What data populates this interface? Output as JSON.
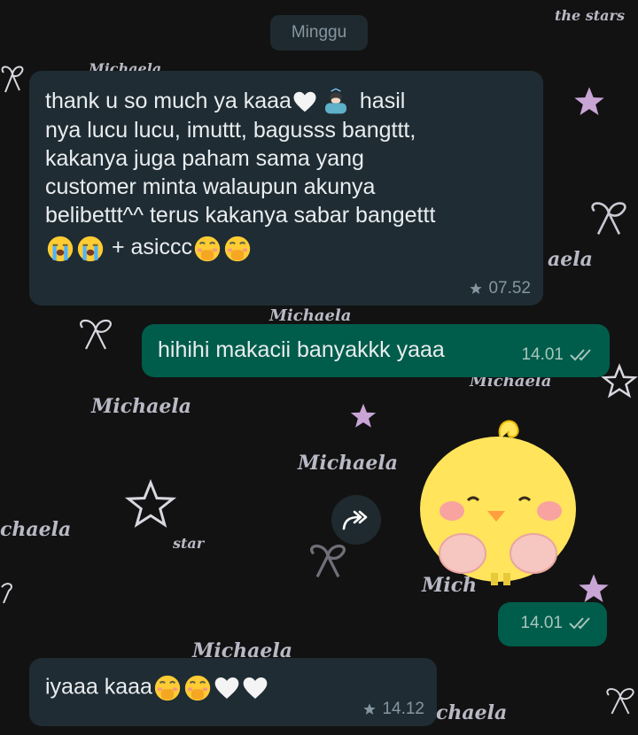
{
  "date_separator": "Minggu",
  "wallpaper": {
    "texts": [
      "the stars",
      "Michaela",
      "Michaela",
      "Michaela",
      "chaela",
      "star",
      "Michaela",
      "aela",
      "Mich",
      "Michaela",
      "chaela",
      "Michaela"
    ],
    "colors": {
      "background": "#121212",
      "text": "#b9b9c6",
      "star": "#c9a5d6"
    }
  },
  "messages": [
    {
      "direction": "incoming",
      "lines": [
        "thank u so much ya kaaa",
        "nya lucu lucu, imuttt, bagusss bangttt,",
        "kakanya juga paham sama yang",
        "customer minta walaupun akunya",
        "belibettt^^ terus kakanya sabar bangettt",
        "+ asiccc"
      ],
      "line1_suffix": "hasil",
      "emojis": [
        "white-heart",
        "person-bowing",
        "loudly-crying-face",
        "loudly-crying-face",
        "face-with-hand-over-mouth",
        "face-with-hand-over-mouth"
      ],
      "starred": true,
      "time": "07.52"
    },
    {
      "direction": "outgoing",
      "text": "hihihi makacii banyakkk yaaa",
      "time": "14.01",
      "status": "read"
    },
    {
      "direction": "outgoing",
      "type": "sticker",
      "sticker": "yellow-chick-covering-face",
      "time": "14.01",
      "status": "read"
    },
    {
      "direction": "incoming",
      "text": "iyaaa kaaa",
      "emojis": [
        "face-with-hand-over-mouth",
        "face-with-hand-over-mouth",
        "white-heart",
        "white-heart"
      ],
      "starred": true,
      "time": "14.12"
    }
  ],
  "forward_button": {
    "icon": "forward-arrow-icon"
  },
  "colors": {
    "incoming_bubble": "#1f2c34",
    "outgoing_bubble": "#005c4b",
    "meta_text": "#8696a0",
    "read_ticks": "#a7c6bd"
  }
}
